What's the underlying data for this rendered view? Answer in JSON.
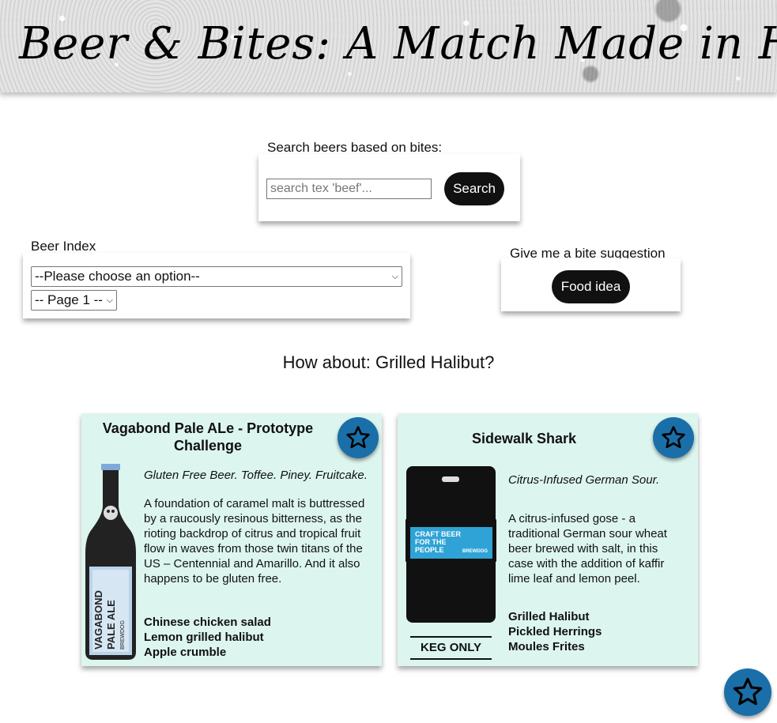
{
  "header": {
    "title": "Beer & Bites: A Match Made in Heaven"
  },
  "search": {
    "label": "Search beers based on bites:",
    "placeholder": "search tex 'beef'...",
    "button": "Search"
  },
  "beer_index": {
    "label": "Beer Index",
    "selected": "--Please choose an option--",
    "page_selected": "-- Page 1 --"
  },
  "bite": {
    "label": "Give me a bite suggestion",
    "button": "Food idea"
  },
  "suggestion": {
    "text": "How about: Grilled Halibut?"
  },
  "cards": [
    {
      "name": "Vagabond Pale ALe - Prototype Challenge",
      "tagline": "Gluten Free Beer. Toffee. Piney. Fruitcake.",
      "description": "A foundation of caramel malt is buttressed by a raucously resinous bitterness, as the rioting backdrop of citrus and tropical fruit flow in waves from those twin titans of the US – Centennial and Amarillo. And it also happens to be gluten free.",
      "pairings": [
        "Chinese chicken salad",
        "Lemon grilled halibut",
        "Apple crumble"
      ],
      "label_text": "BREWDOG VAGABOND PALE ALE"
    },
    {
      "name": "Sidewalk Shark",
      "tagline": "Citrus-Infused German Sour.",
      "description": "A citrus-infused gose - a traditional German sour wheat beer brewed with salt, in this case with the addition of kaffir lime leaf and lemon peel.",
      "pairings": [
        "Grilled Halibut",
        "Pickled Herrings",
        "Moules Frites"
      ],
      "keg_label": "CRAFT BEER FOR THE PEOPLE",
      "keg_brand": "BREWDOG",
      "keg_only": "KEG ONLY"
    }
  ],
  "colors": {
    "accent": "#1a6fa8",
    "card_bg": "#dcf5ee",
    "button_bg": "#111111"
  },
  "icons": {
    "favorite": "star-icon"
  }
}
